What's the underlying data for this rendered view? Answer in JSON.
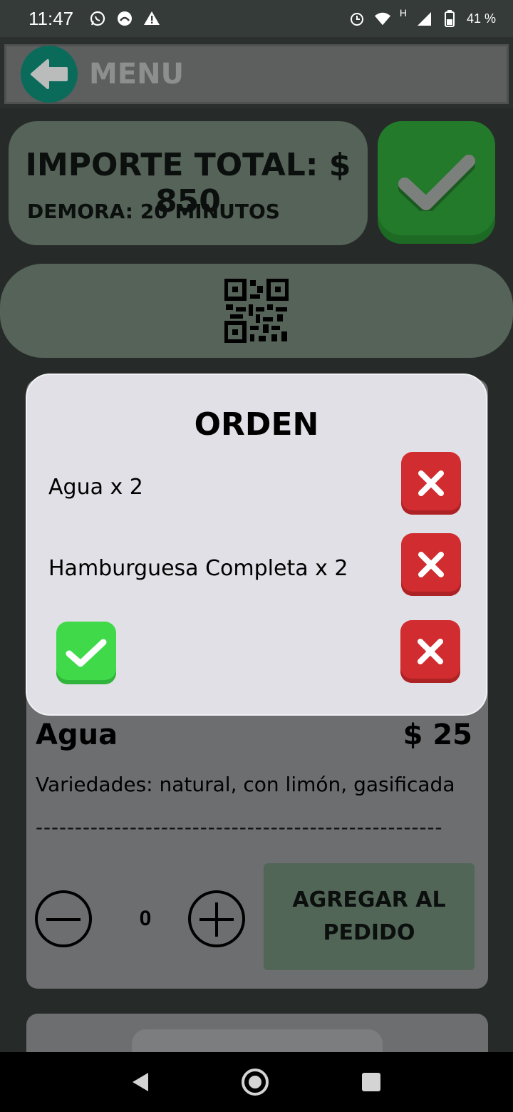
{
  "status_bar": {
    "time": "11:47",
    "left_icons": [
      "whatsapp-icon",
      "notification-icon",
      "warning-icon"
    ],
    "battery": "41 %",
    "network": "H",
    "right_icons": [
      "alarm-icon",
      "wifi-icon",
      "signal-icon",
      "battery-icon"
    ]
  },
  "app_bar": {
    "title": "MENU",
    "back_icon": "arrow-left-icon"
  },
  "summary": {
    "total_label": "IMPORTE TOTAL: $ 850",
    "delay_label": "DEMORA: 20 MINUTOS",
    "confirm_icon": "checkmark-icon"
  },
  "qr": {
    "icon": "qr-code-icon"
  },
  "item": {
    "name": "Agua",
    "price": "$ 25",
    "description": "Variedades: natural, con limón, gasificada",
    "divider": "----------------------------------------------------",
    "quantity": "0",
    "add_label": "AGREGAR AL PEDIDO"
  },
  "dialog": {
    "title": "ORDEN",
    "items": [
      {
        "label": "Agua x 2"
      },
      {
        "label": "Hamburguesa Completa x 2"
      }
    ]
  },
  "colors": {
    "accent_green": "#237a2b",
    "card": "#556358",
    "danger": "#d12c2f",
    "success": "#3fd94a",
    "back_button": "#0b6b5a"
  }
}
